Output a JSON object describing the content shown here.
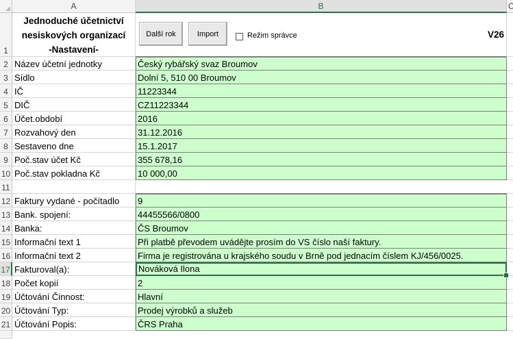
{
  "columns": {
    "a": "A",
    "b": "B",
    "c": "C"
  },
  "title_lines": [
    "Jednoduché účetnictví",
    "nesiskových organizací",
    "-Nastavení-"
  ],
  "buttons": {
    "next_year": "Další rok",
    "import": "Import"
  },
  "admin_checkbox": {
    "label": "Režim správce",
    "checked": false
  },
  "version": "V26",
  "rows": [
    {
      "num": "1"
    },
    {
      "num": "2",
      "label": "Název účetní jednotky",
      "value": "Český rybářský svaz Broumov"
    },
    {
      "num": "3",
      "label": "Sídlo",
      "value": "Dolní 5, 510 00 Broumov"
    },
    {
      "num": "4",
      "label": "IČ",
      "value": "11223344"
    },
    {
      "num": "5",
      "label": "DIČ",
      "value": "CZ11223344"
    },
    {
      "num": "6",
      "label": "Účet.období",
      "value": "2016"
    },
    {
      "num": "7",
      "label": "Rozvahový den",
      "value": "31.12.2016"
    },
    {
      "num": "8",
      "label": "Sestaveno dne",
      "value": "15.1.2017"
    },
    {
      "num": "9",
      "label": "Poč.stav účet Kč",
      "value": "355 678,16"
    },
    {
      "num": "10",
      "label": "Poč.stav pokladna Kč",
      "value": "10 000,00"
    },
    {
      "num": "11",
      "label": "",
      "value": ""
    },
    {
      "num": "12",
      "label": "Faktury vydané - počítadlo",
      "value": "9"
    },
    {
      "num": "13",
      "label": "Bank. spojení:",
      "value": "44455566/0800"
    },
    {
      "num": "14",
      "label": "Banka:",
      "value": "ČS Broumov"
    },
    {
      "num": "15",
      "label": "Informační text 1",
      "value": "Při platbě převodem uvádějte prosím do VS číslo naší faktury."
    },
    {
      "num": "16",
      "label": "Informační text 2",
      "value": "Firma je registrována u krajského soudu v Brně pod jednacím číslem KJ/456/0025."
    },
    {
      "num": "17",
      "label": "Fakturoval(a):",
      "value": "Nováková Ilona"
    },
    {
      "num": "18",
      "label": "Počet kopií",
      "value": "2"
    },
    {
      "num": "19",
      "label": "Účtování Činnost:",
      "value": "Hlavní"
    },
    {
      "num": "20",
      "label": "Účtování Typ:",
      "value": "Prodej výrobků a služeb"
    },
    {
      "num": "21",
      "label": "Účtování Popis:",
      "value": "ČRS Praha"
    }
  ],
  "active_row": "17",
  "colors": {
    "green_fill": "#ccffcc",
    "excel_accent": "#217346"
  }
}
